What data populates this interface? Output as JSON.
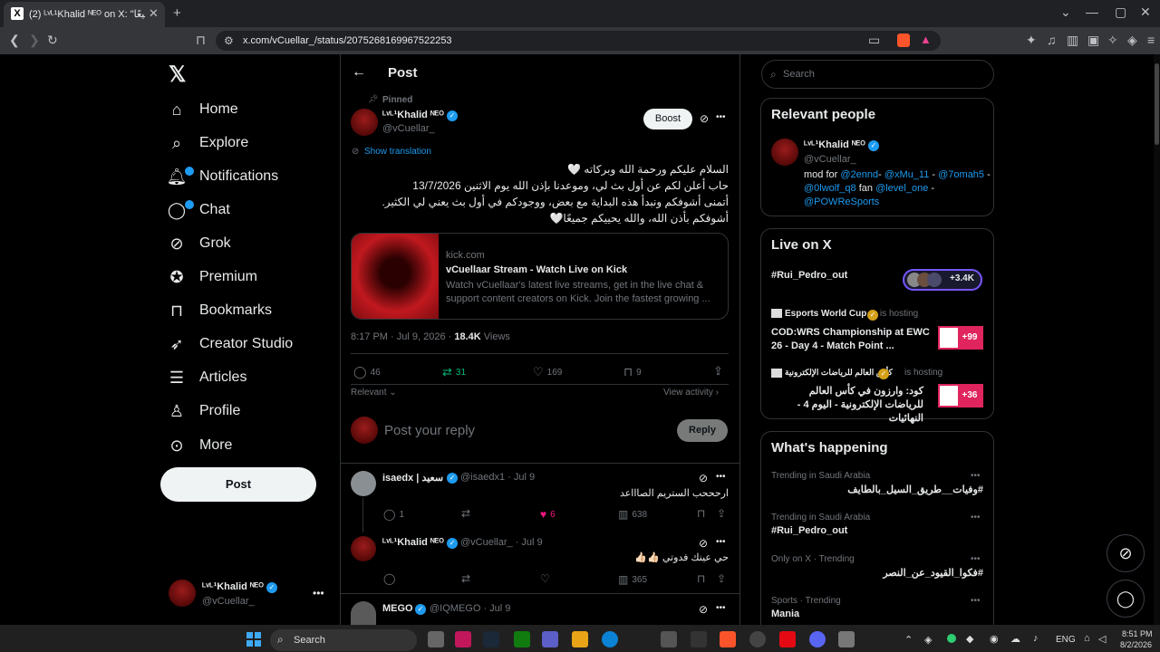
{
  "browser": {
    "tab_title": "(2) ᴸᵛᴸ¹Khalid ᴺᴱᴼ on X: \"يحييكم جميعًا",
    "url": "x.com/vCuellar_/status/2075268169967522253"
  },
  "nav": {
    "home": "Home",
    "explore": "Explore",
    "notifications": "Notifications",
    "chat": "Chat",
    "grok": "Grok",
    "premium": "Premium",
    "bookmarks": "Bookmarks",
    "creator": "Creator Studio",
    "articles": "Articles",
    "profile": "Profile",
    "more": "More",
    "post": "Post"
  },
  "account": {
    "name": "ᴸᵛᴸ¹Khalid ᴺᴱᴼ",
    "handle": "@vCuellar_"
  },
  "header": {
    "title": "Post"
  },
  "post": {
    "pinned": "Pinned",
    "name": "ᴸᵛᴸ¹Khalid ᴺᴱᴼ",
    "handle": "@vCuellar_",
    "boost": "Boost",
    "translate": "Show translation",
    "lines": [
      "السلام عليكم ورحمة الله وبركاته 🤍",
      "حاب أعلن لكم عن أول بث لي، وموعدنا بإذن الله يوم الاثنين 13/7/2026",
      "أتمنى أشوفكم ونبدأ هذه البداية مع بعض، ووجودكم في أول بث يعني لي الكثير.",
      "أشوفكم بأذن الله، والله يحييكم جميعًا🤍"
    ],
    "card": {
      "domain": "kick.com",
      "title": "vCuellaar Stream - Watch Live on Kick",
      "desc": "Watch vCuellaar's latest live streams, get in the live chat & support content creators on Kick. Join the fastest growing ..."
    },
    "time": "8:17 PM · Jul 9, 2026 · ",
    "views": "18.4K",
    "views_label": " Views",
    "replies": "46",
    "reposts": "31",
    "likes": "169",
    "bookmarks": "9",
    "relevant": "Relevant",
    "view_activity": "View activity"
  },
  "reply_box": {
    "placeholder": "Post your reply",
    "button": "Reply"
  },
  "replies": [
    {
      "name": "isaedx | سعيد",
      "handle": "@isaedx1 · Jul 9",
      "text": "ارحححب الستريم الصاااعد",
      "r": "1",
      "l": "6",
      "v": "638"
    },
    {
      "name": "ᴸᵛᴸ¹Khalid ᴺᴱᴼ",
      "handle": "@vCuellar_ · Jul 9",
      "text": "حي عينك فدوتي 👍🏻👍🏻",
      "v": "365"
    },
    {
      "name": "MEGO",
      "handle": "@IQMEGO · Jul 9",
      "text": ""
    }
  ],
  "search": {
    "placeholder": "Search"
  },
  "relevant_people": {
    "title": "Relevant people",
    "name": "ᴸᵛᴸ¹Khalid ᴺᴱᴼ",
    "handle": "@vCuellar_",
    "bio_pre": "mod for ",
    "m1": "@2ennd",
    "m2": "@xMu_11",
    "m3": "@7omah5",
    "m4": "@0lwolf_q8",
    "fan": " fan ",
    "m5": "@level_one",
    "m6": "@POWReSports"
  },
  "live": {
    "title": "Live on X",
    "t1": "#Rui_Pedro_out",
    "c1": "+3.4K",
    "h2": "Esports World Cup",
    "hosting": "is hosting",
    "t2": "COD:WRS Championship at EWC 26 - Day 4 - Match Point ...",
    "c2": "+99",
    "h3": "كأس العالم للرياضات الإلكترونية",
    "t3": "كود: وارزون في كأس العالم للرياضات الإلكترونية - اليوم 4 - النهائيات",
    "c3": "+36"
  },
  "happening": {
    "title": "What's happening",
    "items": [
      {
        "meta": "Trending in Saudi Arabia",
        "topic": "#وفيات__طريق_السيل_بالطايف"
      },
      {
        "meta": "Trending in Saudi Arabia",
        "topic": "#Rui_Pedro_out"
      },
      {
        "meta": "Only on X · Trending",
        "topic": "#فكوا_القيود_عن_النصر"
      },
      {
        "meta": "Sports · Trending",
        "topic": "Mania"
      }
    ]
  },
  "taskbar": {
    "search": "Search",
    "lang": "ENG",
    "time": "8:51 PM",
    "date": "8/2/2026"
  },
  "colors": {
    "accent": "#1d9bf0",
    "repost": "#00ba7c",
    "like": "#f91880",
    "live": "#e0245e"
  }
}
